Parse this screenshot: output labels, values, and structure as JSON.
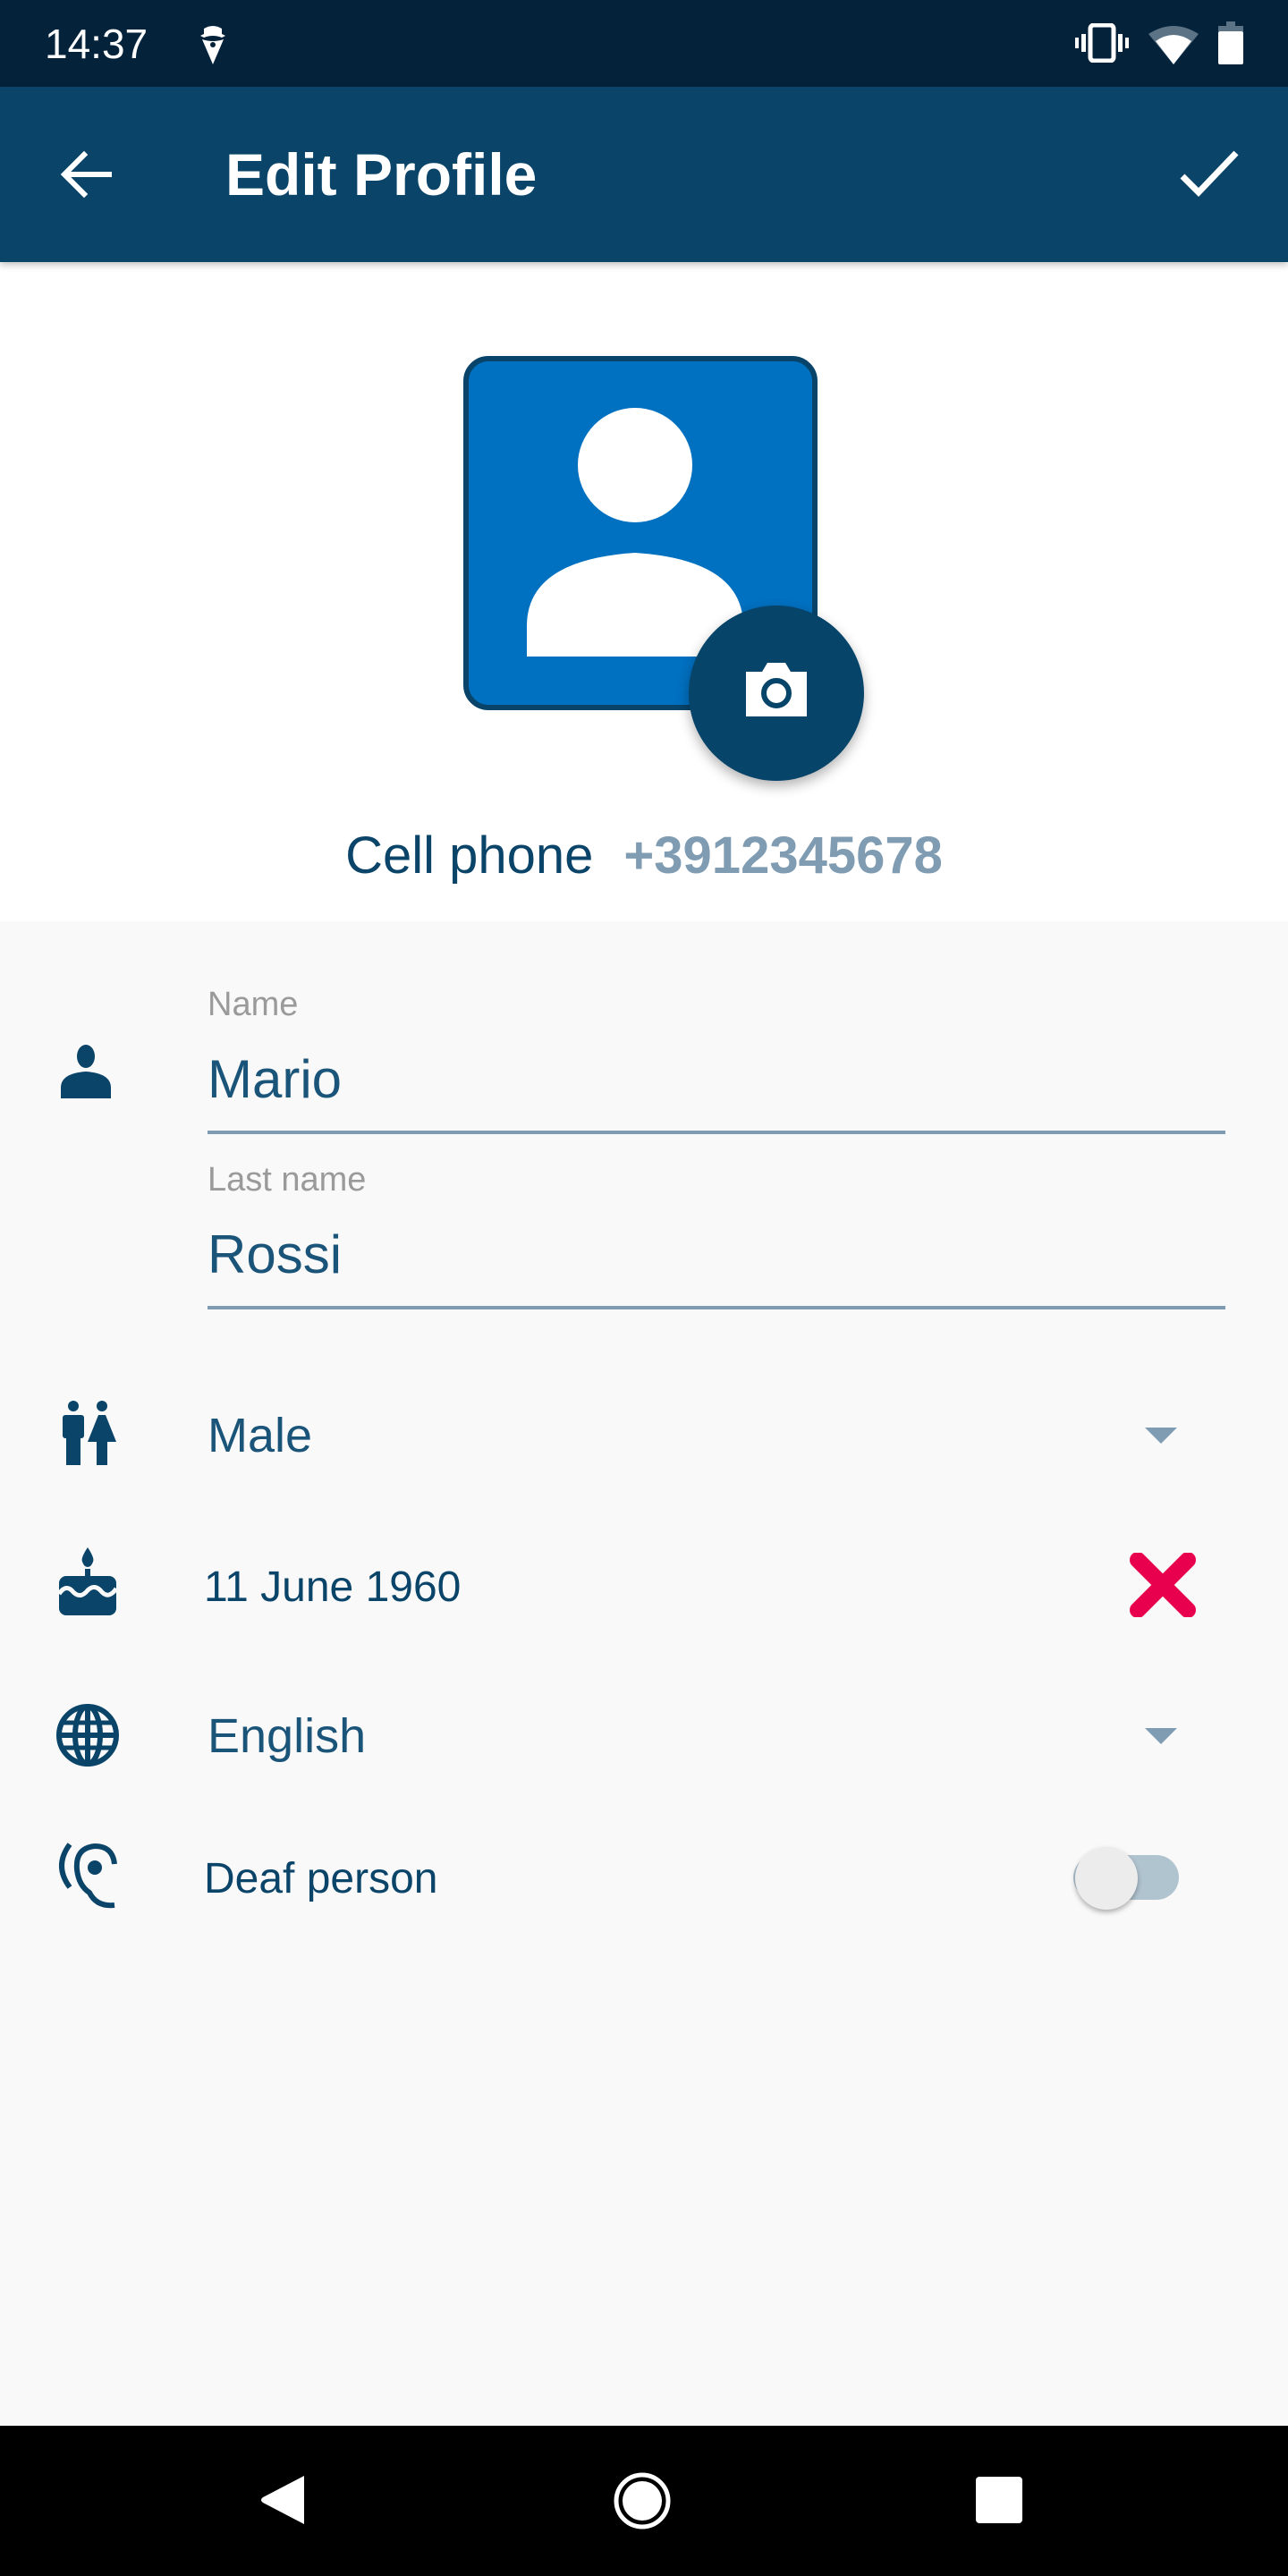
{
  "status_bar": {
    "time": "14:37",
    "icons": [
      "incognito-icon",
      "vibrate-icon",
      "wifi-icon",
      "battery-icon"
    ]
  },
  "app_bar": {
    "title": "Edit Profile",
    "back_icon": "arrow-left-icon",
    "confirm_icon": "check-icon"
  },
  "profile": {
    "avatar_icon": "person-placeholder-icon",
    "camera_icon": "camera-icon",
    "phone_label": "Cell phone",
    "phone_value": "+3912345678"
  },
  "form": {
    "name": {
      "label": "Name",
      "value": "Mario",
      "icon": "person-icon"
    },
    "last_name": {
      "label": "Last name",
      "value": "Rossi"
    },
    "gender": {
      "value": "Male",
      "icon": "gender-icon"
    },
    "birthday": {
      "value": "11 June 1960",
      "icon": "cake-icon",
      "clear_icon": "clear-x-icon"
    },
    "language": {
      "value": "English",
      "icon": "globe-icon"
    },
    "deaf": {
      "label": "Deaf person",
      "icon": "ear-icon",
      "enabled": false
    }
  },
  "colors": {
    "status_bar": "#04233b",
    "app_bar": "#0a4469",
    "avatar_bg": "#0070c0",
    "accent": "#07446a",
    "muted": "#7f9cb2",
    "clear": "#e8004f"
  },
  "nav_bar": {
    "icons": [
      "back-triangle-icon",
      "home-circle-icon",
      "recents-square-icon"
    ]
  }
}
